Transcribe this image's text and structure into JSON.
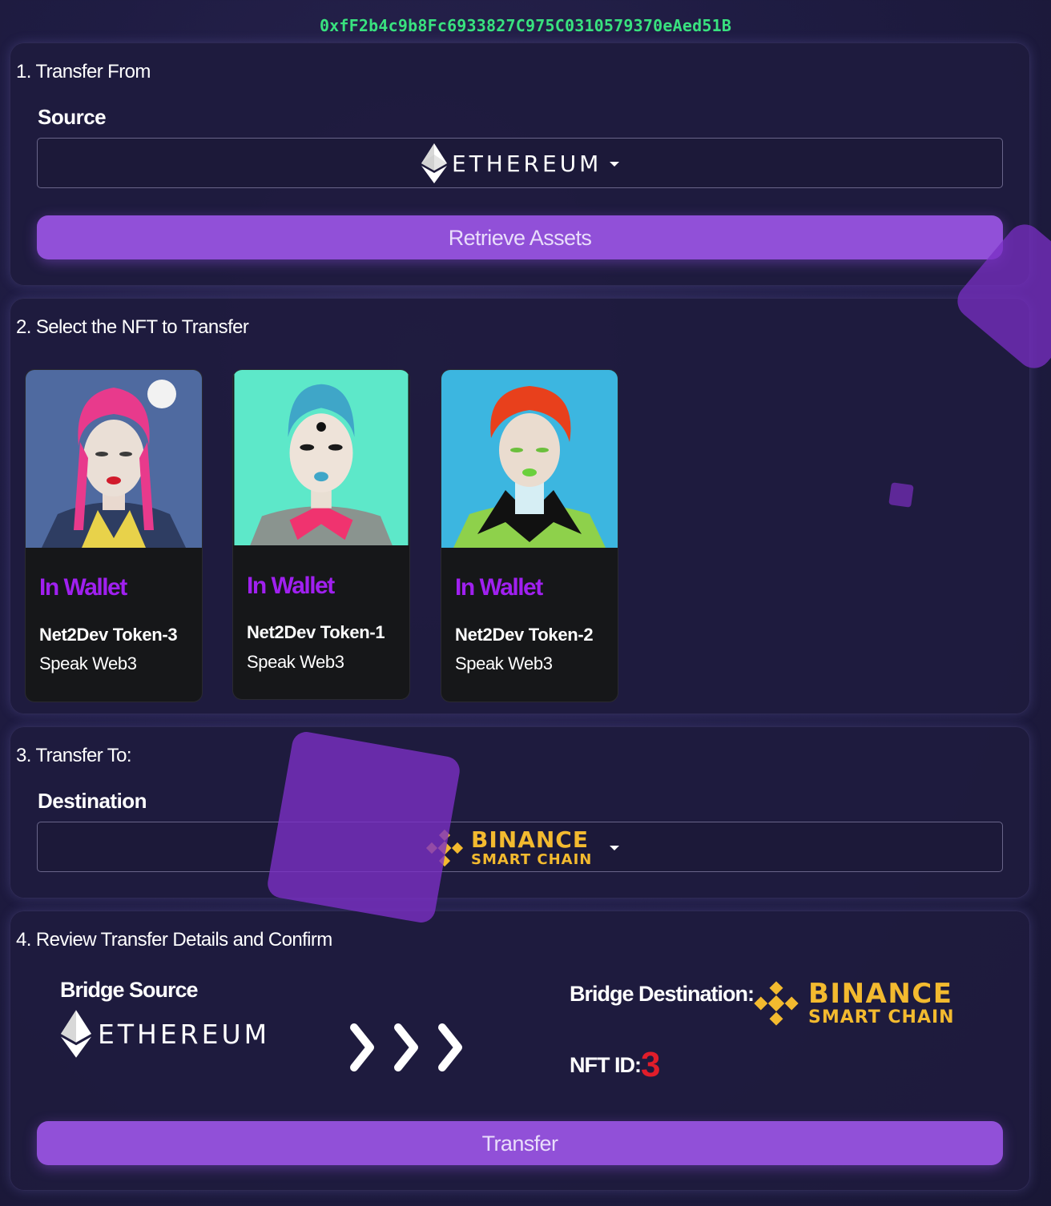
{
  "wallet": {
    "address": "0xfF2b4c9b8Fc6933827C975C0310579370eAed51B"
  },
  "step1": {
    "title": "1. Transfer From",
    "source_label": "Source",
    "source_value": "ETHEREUM",
    "retrieve_label": "Retrieve Assets"
  },
  "step2": {
    "title": "2. Select the NFT to Transfer",
    "nfts": [
      {
        "status": "In Wallet",
        "name": "Net2Dev Token-3",
        "collection": "Speak Web3",
        "bg": "#4f6aa0",
        "hair": "#e83a8c",
        "collar": "#e8d24a",
        "jacket": "#2e3d62"
      },
      {
        "status": "In Wallet",
        "name": "Net2Dev Token-1",
        "collection": "Speak Web3",
        "bg": "#5de8c9",
        "hair": "#3fa6c8",
        "collar": "#f0336f",
        "jacket": "#8a948f"
      },
      {
        "status": "In Wallet",
        "name": "Net2Dev Token-2",
        "collection": "Speak Web3",
        "bg": "#3cb6e0",
        "hair": "#e8401c",
        "collar": "#111111",
        "jacket": "#8ed14b"
      }
    ]
  },
  "step3": {
    "title": "3. Transfer To:",
    "destination_label": "Destination",
    "destination_value": "BINANCE SMART CHAIN",
    "bnb_line1": "BINANCE",
    "bnb_line2": "SMART CHAIN"
  },
  "step4": {
    "title": "4. Review Transfer Details and Confirm",
    "bridge_source_label": "Bridge Source",
    "bridge_source_value": "ETHEREUM",
    "bridge_destination_label": "Bridge Destination:",
    "bnb_line1": "BINANCE",
    "bnb_line2": "SMART CHAIN",
    "nft_id_label": "NFT ID:",
    "nft_id_value": "3",
    "transfer_label": "Transfer"
  },
  "colors": {
    "accent": "#9150d8",
    "address": "#39e27f",
    "status": "#a020f0",
    "binance": "#f3ba2f",
    "nft_id": "#e11d2a"
  }
}
